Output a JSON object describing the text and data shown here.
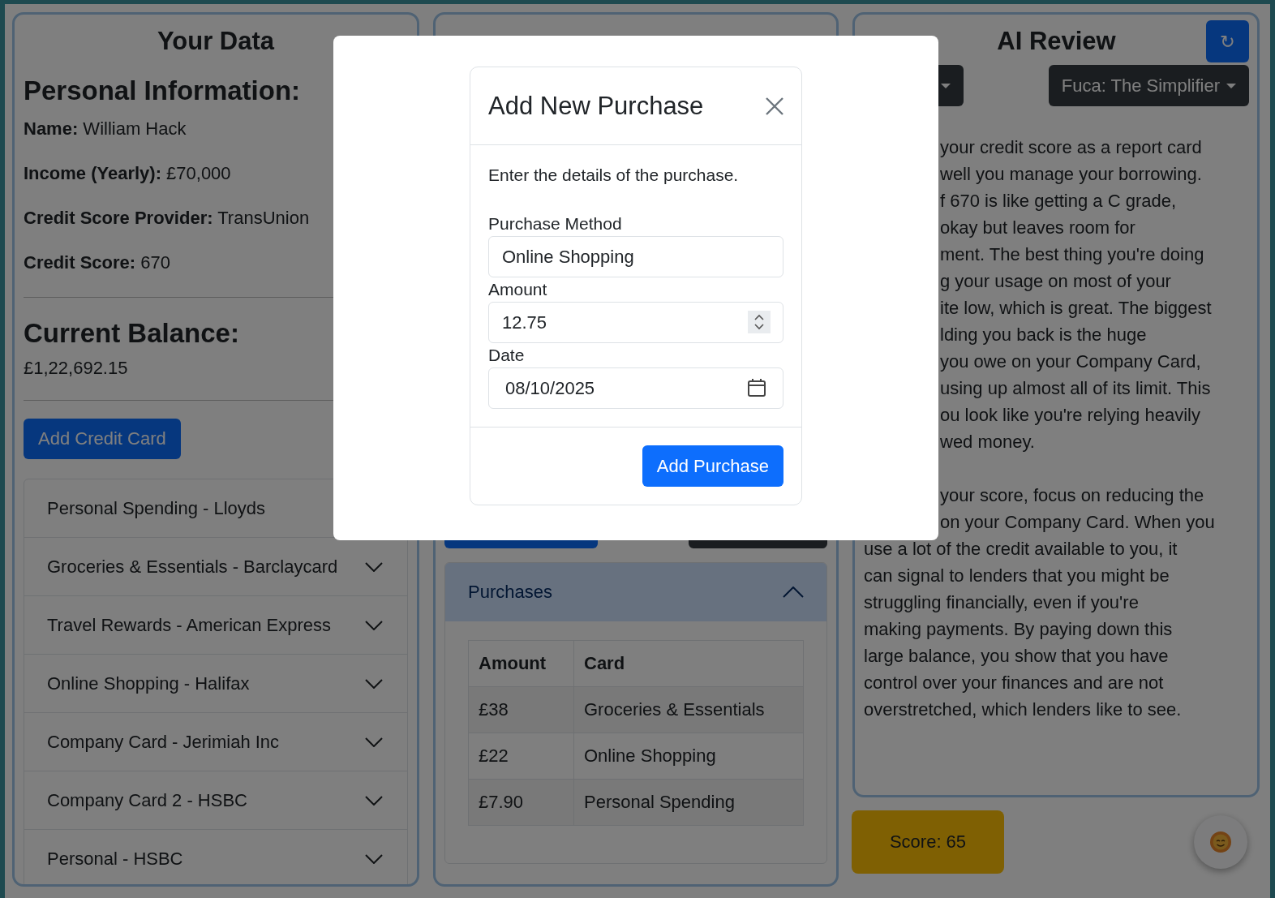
{
  "your_data": {
    "title": "Your Data",
    "section_title": "Personal Information:",
    "fields": [
      {
        "label": "Name:",
        "value": "William Hack"
      },
      {
        "label": "Income (Yearly):",
        "value": "£70,000"
      },
      {
        "label": "Credit Score Provider:",
        "value": "TransUnion"
      },
      {
        "label": "Credit Score:",
        "value": "670"
      }
    ],
    "balance_title": "Current Balance:",
    "balance": "£1,22,692.15",
    "add_button": "Add Credit Card",
    "cards": [
      {
        "label": "Personal Spending - Lloyds",
        "expanded": false
      },
      {
        "label": "Groceries & Essentials - Barclaycard",
        "expanded": false
      },
      {
        "label": "Travel Rewards - American Express",
        "expanded": false
      },
      {
        "label": "Online Shopping - Halifax",
        "expanded": false
      },
      {
        "label": "Company Card - Jerimiah Inc",
        "expanded": false
      },
      {
        "label": "Company Card 2 - HSBC",
        "expanded": false
      },
      {
        "label": "Personal - HSBC",
        "expanded": false
      }
    ]
  },
  "payments_form": {
    "buttons": [
      {
        "kind": "primary"
      },
      {
        "kind": "dark"
      }
    ],
    "purchases": {
      "title": "Purchases",
      "expanded": true,
      "columns": [
        "Amount",
        "Card"
      ],
      "rows": [
        [
          "£38",
          "Groceries & Essentials"
        ],
        [
          "£22",
          "Online Shopping"
        ],
        [
          "£7.90",
          "Personal Spending"
        ]
      ]
    }
  },
  "ai_review": {
    "title": "AI Review",
    "refresh": "↻",
    "dropdowns": [
      {
        "kind": "covered"
      },
      {
        "kind": "labelled",
        "label": "Fuca: The Simplifier"
      }
    ],
    "paragraphs": [
      [
        "your credit score as a report card",
        "well you manage your borrowing.",
        "f 670 is like getting a C grade,",
        "okay but leaves room for",
        "ment. The best thing you're doing",
        "g your usage on most of your",
        "ite low, which is great. The biggest",
        "lding you back is the huge",
        "you owe on your Company Card,",
        "using up almost all of its limit. This",
        "ou look like you're relying heavily",
        "wed money."
      ],
      [
        "your score, focus on reducing the",
        "on your Company Card. When you",
        "use a lot of the credit available to you, it",
        "can signal to lenders that you might be",
        "struggling financially, even if you're",
        "making payments. By paying down this",
        "large balance, you show that you have",
        "control over your finances and are not",
        "overstretched, which lenders like to see."
      ]
    ],
    "score": "Score: 65"
  },
  "modal": {
    "title": "Add New Purchase",
    "description": "Enter the details of the purchase.",
    "fields": [
      {
        "kind": "text",
        "label": "Purchase Method",
        "value": "Online Shopping"
      },
      {
        "kind": "number",
        "label": "Amount",
        "value": "12.75"
      },
      {
        "kind": "date",
        "label": "Date",
        "value": "08/10/2025"
      }
    ],
    "submit": "Add Purchase"
  }
}
